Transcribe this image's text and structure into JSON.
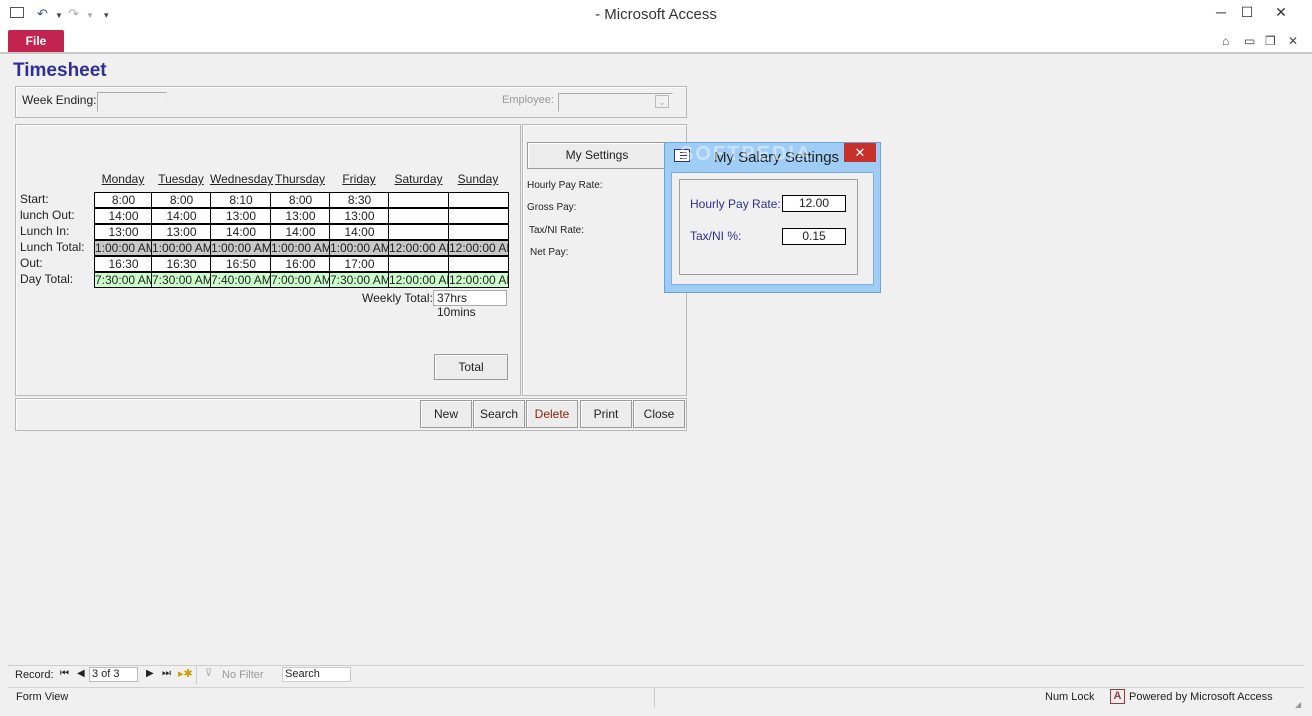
{
  "window": {
    "title": "-  Microsoft Access",
    "minimize_glyph": "─",
    "maximize_glyph": "☐",
    "close_glyph": "✕"
  },
  "ribbon": {
    "file_tab": "File"
  },
  "form": {
    "title": "Timesheet",
    "week_ending_label": "Week Ending:",
    "employee_label": "Employee:",
    "days": [
      "Monday",
      "Tuesday",
      "Wednesday",
      "Thursday",
      "Friday",
      "Saturday",
      "Sunday"
    ],
    "rows": [
      {
        "label": "Start:",
        "style": "white",
        "values": [
          "8:00",
          "8:00",
          "8:10",
          "8:00",
          "8:30",
          "",
          ""
        ]
      },
      {
        "label": "lunch Out:",
        "style": "white",
        "values": [
          "14:00",
          "14:00",
          "13:00",
          "13:00",
          "13:00",
          "",
          ""
        ]
      },
      {
        "label": "Lunch In:",
        "style": "white",
        "values": [
          "13:00",
          "13:00",
          "14:00",
          "14:00",
          "14:00",
          "",
          ""
        ]
      },
      {
        "label": "Lunch Total:",
        "style": "gray",
        "values": [
          "1:00:00 AM",
          "1:00:00 AM",
          "1:00:00 AM",
          "1:00:00 AM",
          "1:00:00 AM",
          "12:00:00 AM",
          "12:00:00 AM"
        ]
      },
      {
        "label": "Out:",
        "style": "white",
        "values": [
          "16:30",
          "16:30",
          "16:50",
          "16:00",
          "17:00",
          "",
          ""
        ]
      },
      {
        "label": "Day Total:",
        "style": "green",
        "values": [
          "7:30:00 AM",
          "7:30:00 AM",
          "7:40:00 AM",
          "7:00:00 AM",
          "7:30:00 AM",
          "12:00:00 AM",
          "12:00:00 AM"
        ]
      }
    ],
    "weekly_total_label": "Weekly Total:",
    "weekly_total_value": "37hrs 10mins",
    "total_button": "Total",
    "my_settings_button": "My Settings",
    "side_labels": {
      "hourly_pay_rate": "Hourly Pay Rate:",
      "gross_pay": "Gross Pay:",
      "tax_ni_rate": "Tax/NI Rate:",
      "net_pay": "Net Pay:"
    },
    "buttons": {
      "new": "New",
      "search": "Search",
      "delete": "Delete",
      "print": "Print",
      "close": "Close"
    }
  },
  "dialog": {
    "title": "My Salary Settings",
    "hourly_pay_rate_label": "Hourly Pay Rate:",
    "hourly_pay_rate_value": "12.00",
    "tax_ni_label": "Tax/NI %:",
    "tax_ni_value": "0.15",
    "watermark": "SOFTPEDIA"
  },
  "navbar": {
    "record_label": "Record:",
    "record_position": "3 of 3",
    "no_filter": "No Filter",
    "search_placeholder": "Search"
  },
  "statusbar": {
    "view": "Form View",
    "num_lock": "Num Lock",
    "powered_by": "Powered by Microsoft Access"
  },
  "colors": {
    "file_tab": "#c3234f",
    "title_text": "#2e3192",
    "dialog_frame": "#9fcdf5",
    "dialog_close": "#c7302b",
    "delete_text": "#8b2500",
    "green_cell": "#ccffcc",
    "gray_cell": "#c8c8c8"
  }
}
